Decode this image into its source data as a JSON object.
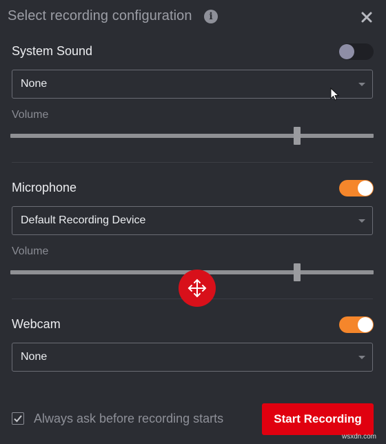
{
  "dialog": {
    "title": "Select recording configuration",
    "info_icon_glyph": "i",
    "close_icon": "close-icon"
  },
  "system_sound": {
    "label": "System Sound",
    "enabled": false,
    "device": "None",
    "volume_label": "Volume",
    "volume_fraction": 0.79
  },
  "microphone": {
    "label": "Microphone",
    "enabled": true,
    "device": "Default Recording Device",
    "volume_label": "Volume",
    "volume_fraction": 0.79
  },
  "webcam": {
    "label": "Webcam",
    "enabled": true,
    "device": "None"
  },
  "footer": {
    "checkbox_checked": true,
    "checkbox_label": "Always ask before recording starts",
    "start_label": "Start Recording"
  },
  "watermark": "wsxdn.com",
  "colors": {
    "background": "#2b2d33",
    "accent_toggle": "#f5862b",
    "start_button": "#e0000f",
    "move_badge": "#d8101a"
  }
}
